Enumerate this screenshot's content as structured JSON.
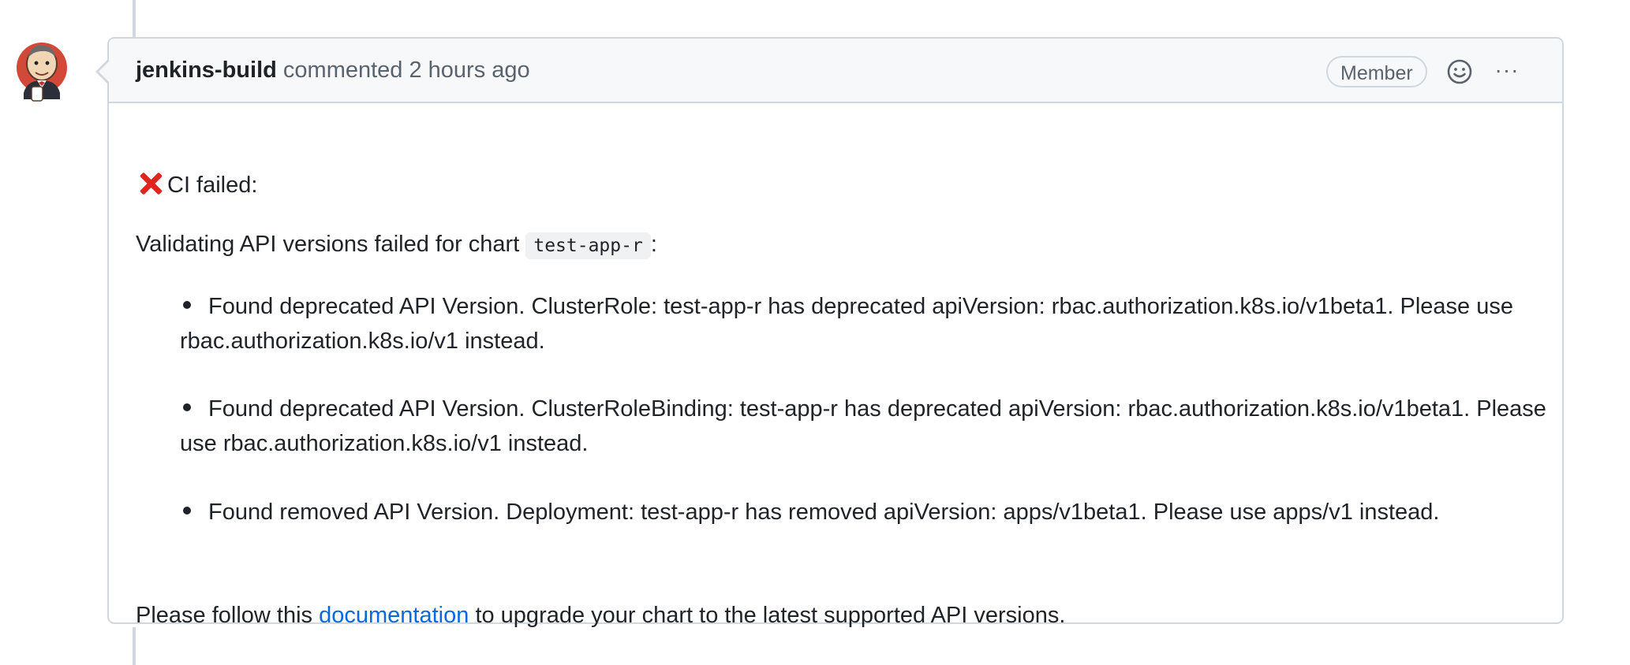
{
  "comment": {
    "author": "jenkins-build",
    "action": "commented",
    "timestamp": "2 hours ago",
    "role_badge": "Member",
    "icons": {
      "avatar": "jenkins-avatar",
      "reaction": "smiley-icon",
      "more": "kebab-horizontal-icon",
      "status": "cross-mark-icon"
    },
    "more_glyph": "···",
    "body": {
      "status_line": "CI failed:",
      "intro_prefix": "Validating API versions failed for chart",
      "chart_name": "test-app-r",
      "intro_suffix": ":",
      "bullets": [
        "Found deprecated API Version. ClusterRole: test-app-r has deprecated apiVersion: rbac.authorization.k8s.io/v1beta1. Please use rbac.authorization.k8s.io/v1 instead.",
        "Found deprecated API Version. ClusterRoleBinding: test-app-r has deprecated apiVersion: rbac.authorization.k8s.io/v1beta1. Please use rbac.authorization.k8s.io/v1 instead.",
        "Found removed API Version. Deployment: test-app-r has removed apiVersion: apps/v1beta1. Please use apps/v1 instead."
      ],
      "footer_prefix": "Please follow this",
      "footer_link": "documentation",
      "footer_suffix": "to upgrade your chart to the latest supported API versions."
    }
  },
  "colors": {
    "link": "#0969da",
    "error": "#e0251e",
    "border": "#d0d7de",
    "header_bg": "#f6f8fa"
  }
}
